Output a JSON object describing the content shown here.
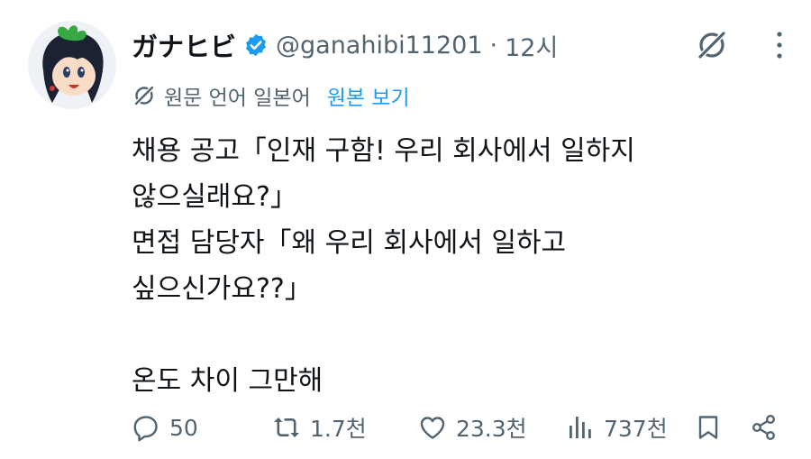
{
  "author": {
    "display_name": "ガナヒビ",
    "handle": "@ganahibi11201",
    "separator": "·",
    "time": "12시"
  },
  "translation": {
    "label": "원문 언어 일본어",
    "show_original": "원본 보기"
  },
  "post": {
    "lines": [
      "채용 공고「인재 구함! 우리 회사에서 일하지",
      "않으실래요?」",
      "면접 담당자「왜 우리 회사에서 일하고",
      "싶으신가요??」",
      "",
      "온도 차이 그만해"
    ]
  },
  "actions": {
    "replies": "50",
    "reposts": "1.7천",
    "likes": "23.3천",
    "views": "737천"
  },
  "colors": {
    "text": "#0f1419",
    "secondary": "#536471",
    "link": "#1d9bf0",
    "verified": "#1d9bf0"
  }
}
